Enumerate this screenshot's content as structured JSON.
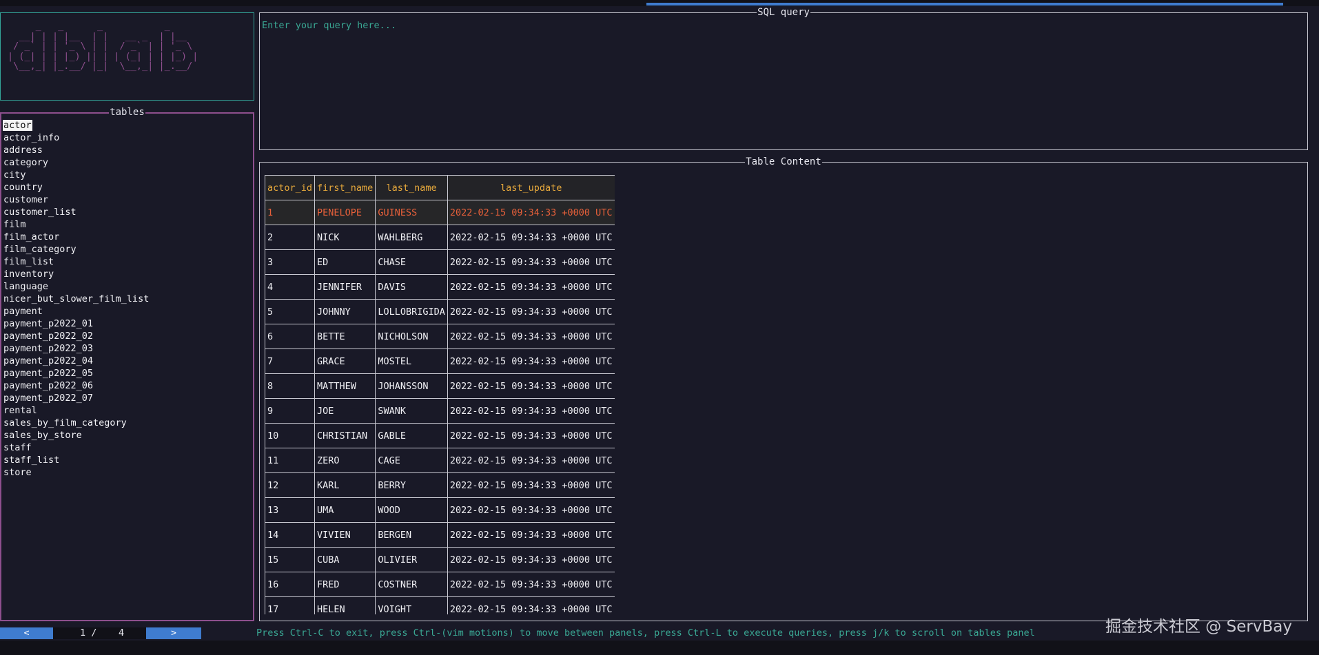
{
  "logo": {
    "ascii": "     _   _      _           _\n  __| | | |__  | |   __ _  | |__\n / _` | | '_ \\ | |  / _` | | '_ \\\n| (_| | | |_) || | | (_| | | |_) |\n \\__,_| |_.__/ |_|  \\__,_| |_.__/"
  },
  "tables_panel": {
    "title": "tables",
    "items": [
      "actor",
      "actor_info",
      "address",
      "category",
      "city",
      "country",
      "customer",
      "customer_list",
      "film",
      "film_actor",
      "film_category",
      "film_list",
      "inventory",
      "language",
      "nicer_but_slower_film_list",
      "payment",
      "payment_p2022_01",
      "payment_p2022_02",
      "payment_p2022_03",
      "payment_p2022_04",
      "payment_p2022_05",
      "payment_p2022_06",
      "payment_p2022_07",
      "rental",
      "sales_by_film_category",
      "sales_by_store",
      "staff",
      "staff_list",
      "store"
    ],
    "selected": "actor"
  },
  "sql_panel": {
    "title": "SQL query",
    "placeholder": "Enter your query here..."
  },
  "content_panel": {
    "title": "Table Content",
    "columns": [
      "actor_id",
      "first_name",
      "last_name",
      "last_update"
    ],
    "rows": [
      [
        "1",
        "PENELOPE",
        "GUINESS",
        "2022-02-15 09:34:33 +0000 UTC"
      ],
      [
        "2",
        "NICK",
        "WAHLBERG",
        "2022-02-15 09:34:33 +0000 UTC"
      ],
      [
        "3",
        "ED",
        "CHASE",
        "2022-02-15 09:34:33 +0000 UTC"
      ],
      [
        "4",
        "JENNIFER",
        "DAVIS",
        "2022-02-15 09:34:33 +0000 UTC"
      ],
      [
        "5",
        "JOHNNY",
        "LOLLOBRIGIDA",
        "2022-02-15 09:34:33 +0000 UTC"
      ],
      [
        "6",
        "BETTE",
        "NICHOLSON",
        "2022-02-15 09:34:33 +0000 UTC"
      ],
      [
        "7",
        "GRACE",
        "MOSTEL",
        "2022-02-15 09:34:33 +0000 UTC"
      ],
      [
        "8",
        "MATTHEW",
        "JOHANSSON",
        "2022-02-15 09:34:33 +0000 UTC"
      ],
      [
        "9",
        "JOE",
        "SWANK",
        "2022-02-15 09:34:33 +0000 UTC"
      ],
      [
        "10",
        "CHRISTIAN",
        "GABLE",
        "2022-02-15 09:34:33 +0000 UTC"
      ],
      [
        "11",
        "ZERO",
        "CAGE",
        "2022-02-15 09:34:33 +0000 UTC"
      ],
      [
        "12",
        "KARL",
        "BERRY",
        "2022-02-15 09:34:33 +0000 UTC"
      ],
      [
        "13",
        "UMA",
        "WOOD",
        "2022-02-15 09:34:33 +0000 UTC"
      ],
      [
        "14",
        "VIVIEN",
        "BERGEN",
        "2022-02-15 09:34:33 +0000 UTC"
      ],
      [
        "15",
        "CUBA",
        "OLIVIER",
        "2022-02-15 09:34:33 +0000 UTC"
      ],
      [
        "16",
        "FRED",
        "COSTNER",
        "2022-02-15 09:34:33 +0000 UTC"
      ],
      [
        "17",
        "HELEN",
        "VOIGHT",
        "2022-02-15 09:34:33 +0000 UTC"
      ]
    ],
    "active_row": 0
  },
  "pager": {
    "prev_label": "<",
    "next_label": ">",
    "current": "1 /",
    "total": "4"
  },
  "help_text": "Press Ctrl-C to exit, press Ctrl-(vim motions) to move between panels, press Ctrl-L to execute queries, press j/k to scroll on tables panel",
  "watermark": "掘金技术社区 @ ServBay",
  "colors": {
    "background": "#191927",
    "logo_border": "#33a69a",
    "tables_border": "#8e4f8e",
    "header_text": "#e7a93c",
    "active_row_text": "#e8603a",
    "accent_blue": "#3f7ccf",
    "help_text": "#3aa894"
  }
}
